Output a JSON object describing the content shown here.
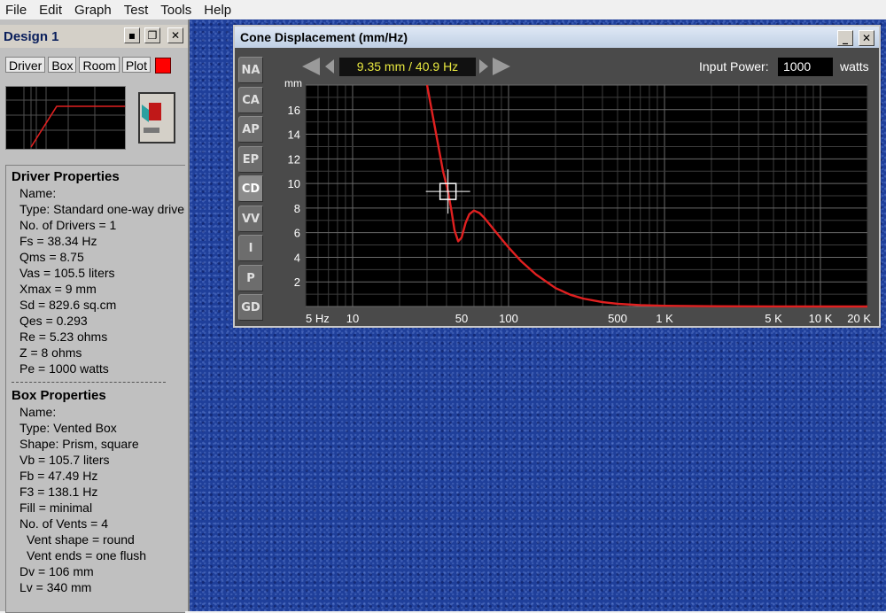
{
  "menu": [
    "File",
    "Edit",
    "Graph",
    "Test",
    "Tools",
    "Help"
  ],
  "design": {
    "title": "Design 1",
    "tabs": [
      "Driver",
      "Box",
      "Room",
      "Plot"
    ],
    "plot_color": "#ff0000"
  },
  "driver_properties": {
    "heading": "Driver Properties",
    "lines": [
      "Name:",
      "Type: Standard one-way driver",
      "No. of Drivers = 1",
      "Fs =  38.34 Hz",
      "Qms =  8.75",
      "Vas =  105.5 liters",
      "Xmax =  9 mm",
      "Sd =  829.6 sq.cm",
      "Qes =  0.293",
      "Re =  5.23 ohms",
      "Z =  8 ohms",
      "Pe =  1000 watts"
    ]
  },
  "box_properties": {
    "heading": "Box Properties",
    "lines": [
      "Name:",
      "Type: Vented Box",
      "Shape: Prism, square",
      "Vb =  105.7 liters",
      "Fb =  47.49 Hz",
      "F3 =  138.1 Hz",
      "Fill = minimal",
      "No. of Vents = 4"
    ],
    "sub_lines": [
      "Vent shape = round",
      "Vent ends = one flush",
      "Dv =  106 mm",
      "Lv =  340 mm"
    ]
  },
  "graph_window": {
    "title": "Cone Displacement (mm/Hz)",
    "side_tabs": [
      "NA",
      "CA",
      "AP",
      "EP",
      "CD",
      "VV",
      "I",
      "P",
      "GD"
    ],
    "active_tab": "CD",
    "readout": "9.35 mm / 40.9 Hz",
    "input_power_label": "Input Power:",
    "input_power_value": "1000",
    "input_power_unit": "watts"
  },
  "chart_data": {
    "type": "line",
    "ylabel": "mm",
    "y_ticks": [
      2,
      4,
      6,
      8,
      10,
      12,
      14,
      16
    ],
    "ylim": [
      0,
      18
    ],
    "x_scale": "log",
    "xlim": [
      5,
      20000
    ],
    "x_tick_labels": [
      {
        "value": 5,
        "label": "5 Hz"
      },
      {
        "value": 10,
        "label": "10"
      },
      {
        "value": 50,
        "label": "50"
      },
      {
        "value": 100,
        "label": "100"
      },
      {
        "value": 500,
        "label": "500"
      },
      {
        "value": 1000,
        "label": "1 K"
      },
      {
        "value": 5000,
        "label": "5 K"
      },
      {
        "value": 10000,
        "label": "10 K"
      },
      {
        "value": 20000,
        "label": "20 K"
      }
    ],
    "grid": true,
    "line_color": "#e02020",
    "series": [
      {
        "x": [
          30,
          33,
          36,
          38,
          40.9,
          43,
          45,
          47.5,
          50,
          53,
          56,
          60,
          65,
          70,
          80,
          90,
          100,
          120,
          150,
          200,
          250,
          300,
          400,
          500,
          700,
          1000,
          2000,
          5000,
          10000,
          20000
        ],
        "y": [
          18,
          15.2,
          12.6,
          11.0,
          9.35,
          7.8,
          6.2,
          5.3,
          5.6,
          6.8,
          7.5,
          7.8,
          7.6,
          7.2,
          6.3,
          5.5,
          4.8,
          3.7,
          2.6,
          1.5,
          0.95,
          0.65,
          0.35,
          0.22,
          0.11,
          0.06,
          0.02,
          0.01,
          0.0,
          0.0
        ]
      }
    ],
    "cursor": {
      "x": 40.9,
      "y": 9.35
    }
  }
}
